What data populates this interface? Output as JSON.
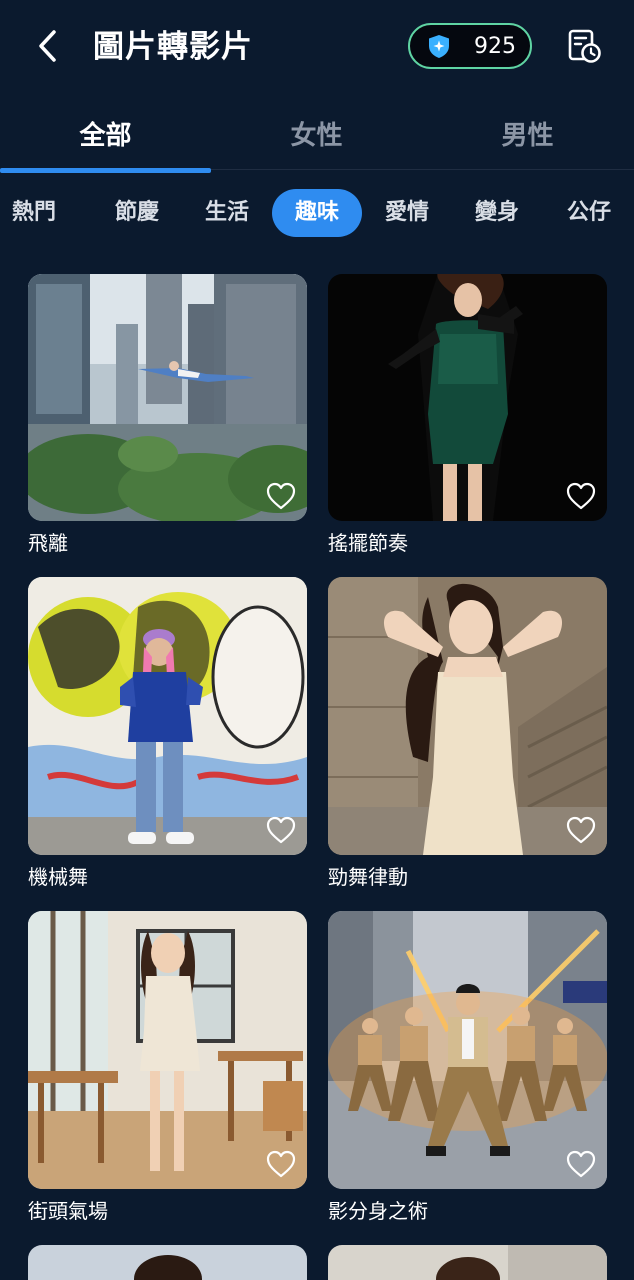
{
  "header": {
    "title": "圖片轉影片",
    "credits": "925"
  },
  "gender_tabs": [
    {
      "label": "全部",
      "active": true
    },
    {
      "label": "女性",
      "active": false
    },
    {
      "label": "男性",
      "active": false
    }
  ],
  "categories": [
    {
      "label": "熱門",
      "active": false
    },
    {
      "label": "節慶",
      "active": false
    },
    {
      "label": "生活",
      "active": false
    },
    {
      "label": "趣味",
      "active": true
    },
    {
      "label": "愛情",
      "active": false
    },
    {
      "label": "變身",
      "active": false
    },
    {
      "label": "公仔",
      "active": false
    }
  ],
  "templates": [
    {
      "label": "飛離"
    },
    {
      "label": "搖擺節奏"
    },
    {
      "label": "機械舞"
    },
    {
      "label": "勁舞律動"
    },
    {
      "label": "街頭氣場"
    },
    {
      "label": "影分身之術"
    }
  ],
  "colors": {
    "background": "#0b1a2e",
    "accent": "#2f8cf0",
    "credit_border": "#5fd4a3"
  }
}
